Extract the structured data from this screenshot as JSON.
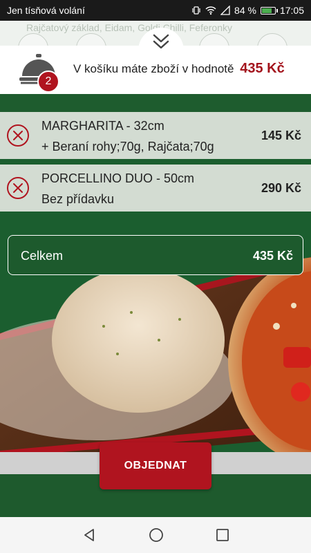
{
  "status_bar": {
    "carrier": "Jen tísňová volání",
    "battery": "84 %",
    "battery_level": 0.84,
    "time": "17:05"
  },
  "background_menu": {
    "text": "Rajčatový základ, Eidam, Goldi Chilli, Feferonky"
  },
  "cart": {
    "count": "2",
    "message": "V košíku máte zboží v hodnotě",
    "amount": "435 Kč"
  },
  "items": [
    {
      "name": "MARGHARITA - 32cm",
      "extra": "+ Beraní rohy;70g, Rajčata;70g",
      "price": "145 Kč"
    },
    {
      "name": "PORCELLINO DUO - 50cm",
      "extra": "Bez přídavku",
      "price": "290 Kč"
    }
  ],
  "total": {
    "label": "Celkem",
    "value": "435 Kč"
  },
  "order_button": "OBJEDNAT",
  "colors": {
    "brand_red": "#b0141f",
    "brand_green": "#1e5c2e",
    "item_bg": "#d3dcd2"
  },
  "icons": {
    "collapse": "chevron-double-down-icon",
    "cart": "serving-cloche-icon",
    "remove": "circle-x-icon",
    "nav_back": "triangle-back-icon",
    "nav_home": "circle-home-icon",
    "nav_recents": "square-recents-icon"
  }
}
